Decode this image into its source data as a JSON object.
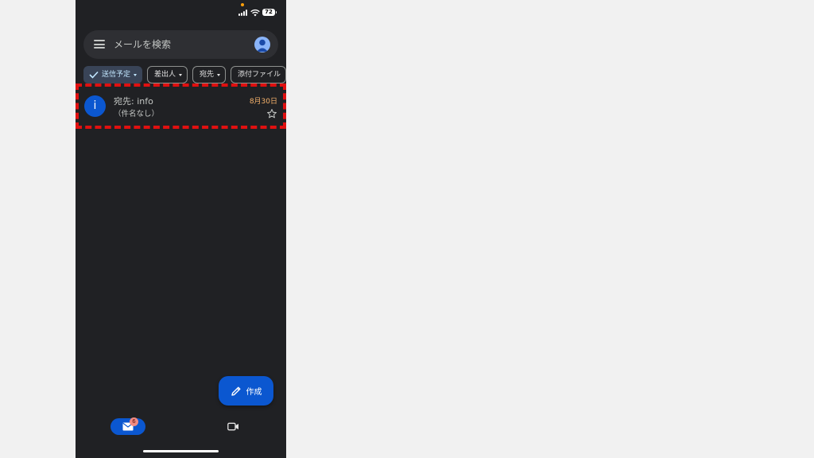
{
  "status_bar": {
    "battery": "72"
  },
  "search": {
    "placeholder": "メールを検索"
  },
  "chips": [
    {
      "label": "送信予定",
      "active": true
    },
    {
      "label": "差出人"
    },
    {
      "label": "宛先"
    },
    {
      "label": "添付ファイル"
    }
  ],
  "email": {
    "avatar_letter": "i",
    "to": "宛先: info",
    "date": "8月30日",
    "subject": "（件名なし）"
  },
  "compose": {
    "label": "作成"
  },
  "nav": {
    "mail_badge": "6"
  },
  "colors": {
    "background": "#202124",
    "accent": "#0b57d0",
    "date": "#f6b26b",
    "highlight": "#e01010"
  }
}
